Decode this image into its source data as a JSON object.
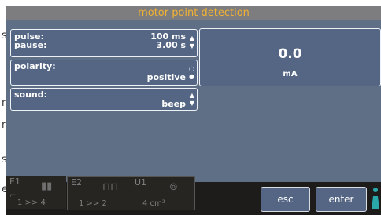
{
  "title": "motor point detection",
  "edge_letters": [
    "s",
    "n",
    "r",
    "s",
    "e"
  ],
  "pulse_panel": {
    "pulse_label": "pulse:",
    "pulse_value": "100 ms",
    "pause_label": "pause:",
    "pause_value": "3.00 s"
  },
  "polarity_panel": {
    "label": "polarity:",
    "value": "positive"
  },
  "sound_panel": {
    "label": "sound:",
    "value": "beep"
  },
  "meter": {
    "value": "0.0",
    "unit": "mA"
  },
  "slots": [
    {
      "id": "E1",
      "sub": "1 >> 4"
    },
    {
      "id": "E2",
      "sub": "1 >> 2"
    },
    {
      "id": "U1",
      "sub": "4 cm²"
    }
  ],
  "buttons": {
    "esc": "esc",
    "enter": "enter"
  },
  "colors": {
    "title_text": "#f2b233",
    "screen_bg": "#5f6f86",
    "panel_bg": "#546684",
    "bottombar_bg": "#1d1c1b"
  }
}
